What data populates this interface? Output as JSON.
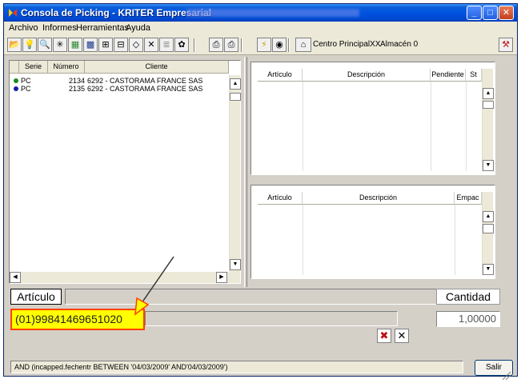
{
  "window": {
    "title": "Consola de Picking - KRITER Empresarial",
    "buttons": {
      "minimize": "_",
      "maximize": "□",
      "close": "✕"
    }
  },
  "menu": [
    {
      "label": "Archivo"
    },
    {
      "label": "Informes"
    },
    {
      "label": "Herramientas"
    },
    {
      "label": "Ayuda"
    }
  ],
  "toolbar": {
    "icons": [
      "open-folder-icon",
      "lightbulb-icon",
      "preview-icon",
      "sparkle-icon",
      "grid-icon",
      "calendar-grid-icon",
      "tree-icon",
      "tree-icon-2",
      "eraser-icon",
      "cross-icon",
      "stack-icon",
      "stamp-icon",
      "printer-icon",
      "printer-icon-2",
      "lightning-icon",
      "disk-icon",
      "monitor-icon",
      "tool-icon"
    ],
    "centro_label": "Centro PrincipalXX",
    "almacen_label": "Almacén 0"
  },
  "orders": {
    "columns": [
      "Serie",
      "Número",
      "Cliente"
    ],
    "rows": [
      {
        "serie": "PC",
        "numero": "2134",
        "cliente": "6292 - CASTORAMA FRANCE SAS",
        "dot_color": "#1a8a1a"
      },
      {
        "serie": "PC",
        "numero": "2135",
        "cliente": "6292 - CASTORAMA FRANCE SAS",
        "dot_color": "#1a1aa8"
      }
    ]
  },
  "lines_grid": {
    "columns": [
      "Artículo",
      "Descripción",
      "Pendiente",
      "St"
    ]
  },
  "packages_grid": {
    "columns": [
      "Artículo",
      "Descripción",
      "Empac"
    ]
  },
  "entry": {
    "articulo_button": "Artículo",
    "barcode_value": "(01)99841469651020",
    "cantidad_label": "Cantidad",
    "cantidad_value": "1,00000"
  },
  "status": {
    "filter_text": "AND (incapped.fechentr BETWEEN '04/03/2009' AND'04/03/2009')",
    "salir_button": "Salir"
  },
  "colors": {
    "titlebar": "#0053e0",
    "highlight_box": "#ffff00",
    "highlight_border": "#ff4000"
  }
}
